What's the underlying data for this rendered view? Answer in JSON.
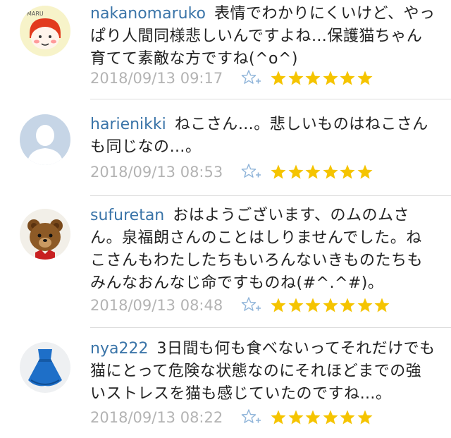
{
  "comments": [
    {
      "username": "nakanomaruko",
      "text": "表情でわかりにくいけど、やっぱり人間同様悲しいんですよね…保護猫ちゃん育てて素敵な方ですね(^o^)",
      "timestamp": "2018/09/13 09:17",
      "stars": 6,
      "avatar": "maru-character-avatar",
      "avatar_label": "MARU"
    },
    {
      "username": "harienikki",
      "text": "ねこさん…。悲しいものはねこさんも同じなの…。",
      "timestamp": "2018/09/13 08:53",
      "stars": 6,
      "avatar": "default-person-avatar"
    },
    {
      "username": "sufuretan",
      "text": "おはようございます、のムのムさん。泉福朗さんのことはしりませんでした。ねこさんもわたしたちもいろんないきものたちもみんなおんなじ命ですものね(#^.^#)。",
      "timestamp": "2018/09/13 08:48",
      "stars": 7,
      "avatar": "teddy-bear-avatar"
    },
    {
      "username": "nya222",
      "text": "3日間も何も食べないってそれだけでも猫にとって危険な状態なのにそれほどまでの強いストレスを猫も感じていたのですね…。",
      "timestamp": "2018/09/13 08:22",
      "stars": 6,
      "avatar": "blue-dress-avatar"
    }
  ],
  "icons": {
    "favorite_add": "star-plus-icon",
    "rating_star": "star-icon"
  },
  "colors": {
    "username": "#3a74a8",
    "text": "#222222",
    "timestamp": "#b3b3b3",
    "star": "#f5c400",
    "fav_icon": "#8fb4d9",
    "divider": "#dcdcdc"
  }
}
